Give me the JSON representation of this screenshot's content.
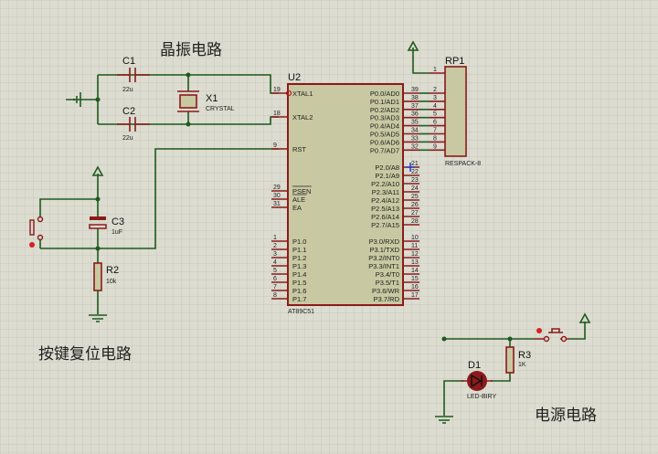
{
  "colors": {
    "wire": "#1e5a1e",
    "component": "#8b1a1a",
    "chip_fill": "#c8c8a2",
    "background": "#dcdcd0",
    "grid": "#c4c4b6"
  },
  "titles": {
    "crystal": "晶振电路",
    "reset": "按键复位电路",
    "power": "电源电路"
  },
  "components": {
    "c1": {
      "ref": "C1",
      "value": "22u"
    },
    "c2": {
      "ref": "C2",
      "value": "22u"
    },
    "x1": {
      "ref": "X1",
      "value": "CRYSTAL"
    },
    "c3": {
      "ref": "C3",
      "value": "1uF"
    },
    "r2": {
      "ref": "R2",
      "value": "10k"
    },
    "r3": {
      "ref": "R3",
      "value": "1K"
    },
    "d1": {
      "ref": "D1",
      "value": "LED-BIRY"
    },
    "rp1": {
      "ref": "RP1",
      "value": "RESPACK-8",
      "pins": [
        "1",
        "2",
        "3",
        "4",
        "5",
        "6",
        "7",
        "8",
        "9"
      ]
    },
    "u2": {
      "ref": "U2",
      "value": "AT89C51"
    }
  },
  "u2_left_pins": [
    {
      "num": "19",
      "name": "XTAL1"
    },
    {
      "num": "18",
      "name": "XTAL2"
    },
    {
      "num": "9",
      "name": "RST"
    },
    {
      "num": "29",
      "name": "PSEN"
    },
    {
      "num": "30",
      "name": "ALE"
    },
    {
      "num": "31",
      "name": "EA"
    },
    {
      "num": "1",
      "name": "P1.0"
    },
    {
      "num": "2",
      "name": "P1.1"
    },
    {
      "num": "3",
      "name": "P1.2"
    },
    {
      "num": "4",
      "name": "P1.3"
    },
    {
      "num": "5",
      "name": "P1.4"
    },
    {
      "num": "6",
      "name": "P1.5"
    },
    {
      "num": "7",
      "name": "P1.6"
    },
    {
      "num": "8",
      "name": "P1.7"
    }
  ],
  "u2_right_pins": [
    {
      "num": "39",
      "name": "P0.0/AD0"
    },
    {
      "num": "38",
      "name": "P0.1/AD1"
    },
    {
      "num": "37",
      "name": "P0.2/AD2"
    },
    {
      "num": "36",
      "name": "P0.3/AD3"
    },
    {
      "num": "35",
      "name": "P0.4/AD4"
    },
    {
      "num": "34",
      "name": "P0.5/AD5"
    },
    {
      "num": "33",
      "name": "P0.6/AD6"
    },
    {
      "num": "32",
      "name": "P0.7/AD7"
    },
    {
      "num": "21",
      "name": "P2.0/A8"
    },
    {
      "num": "22",
      "name": "P2.1/A9"
    },
    {
      "num": "23",
      "name": "P2.2/A10"
    },
    {
      "num": "24",
      "name": "P2.3/A11"
    },
    {
      "num": "25",
      "name": "P2.4/A12"
    },
    {
      "num": "26",
      "name": "P2.5/A13"
    },
    {
      "num": "27",
      "name": "P2.6/A14"
    },
    {
      "num": "28",
      "name": "P2.7/A15"
    },
    {
      "num": "10",
      "name": "P3.0/RXD"
    },
    {
      "num": "11",
      "name": "P3.1/TXD"
    },
    {
      "num": "12",
      "name": "P3.2/INT0"
    },
    {
      "num": "13",
      "name": "P3.3/INT1"
    },
    {
      "num": "14",
      "name": "P3.4/T0"
    },
    {
      "num": "15",
      "name": "P3.5/T1"
    },
    {
      "num": "16",
      "name": "P3.6/WR"
    },
    {
      "num": "17",
      "name": "P3.7/RD"
    }
  ]
}
